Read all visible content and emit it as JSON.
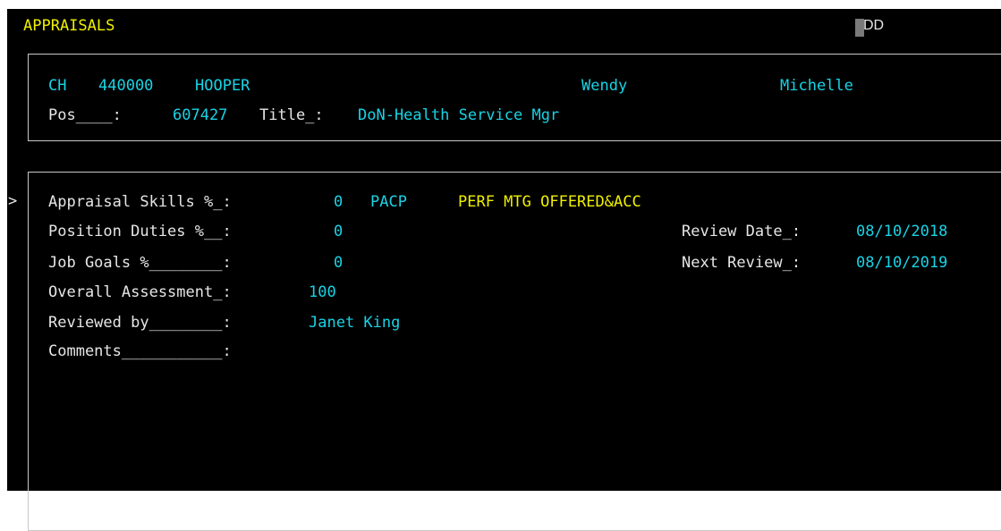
{
  "screen": {
    "title": "APPRAISALS",
    "mode": "ADD",
    "mode_visible": "DD"
  },
  "employee": {
    "code": "CH",
    "number": "440000",
    "last_name": "HOOPER",
    "first_name": "Wendy",
    "middle_name": "Michelle",
    "pos_label": "Pos____:",
    "pos_value": "607427",
    "title_label": "Title_:",
    "title_value": "DoN-Health Service Mgr"
  },
  "appraisal": {
    "row_marker": ">",
    "skills_label": "Appraisal Skills %_:",
    "skills_value": "0",
    "skills_code": "PACP",
    "skills_desc": "PERF MTG OFFERED&ACC",
    "duties_label": "Position Duties %__:",
    "duties_value": "0",
    "goals_label": "Job Goals %________:",
    "goals_value": "0",
    "overall_label": "Overall Assessment_:",
    "overall_value": "100",
    "reviewed_label": "Reviewed by________:",
    "reviewed_value": "Janet King",
    "comments_label": "Comments___________:",
    "comments_value": "",
    "review_date_label": "Review Date_:",
    "review_date_value": "08/10/2018",
    "next_review_label": "Next Review_:",
    "next_review_value": "08/10/2019"
  }
}
